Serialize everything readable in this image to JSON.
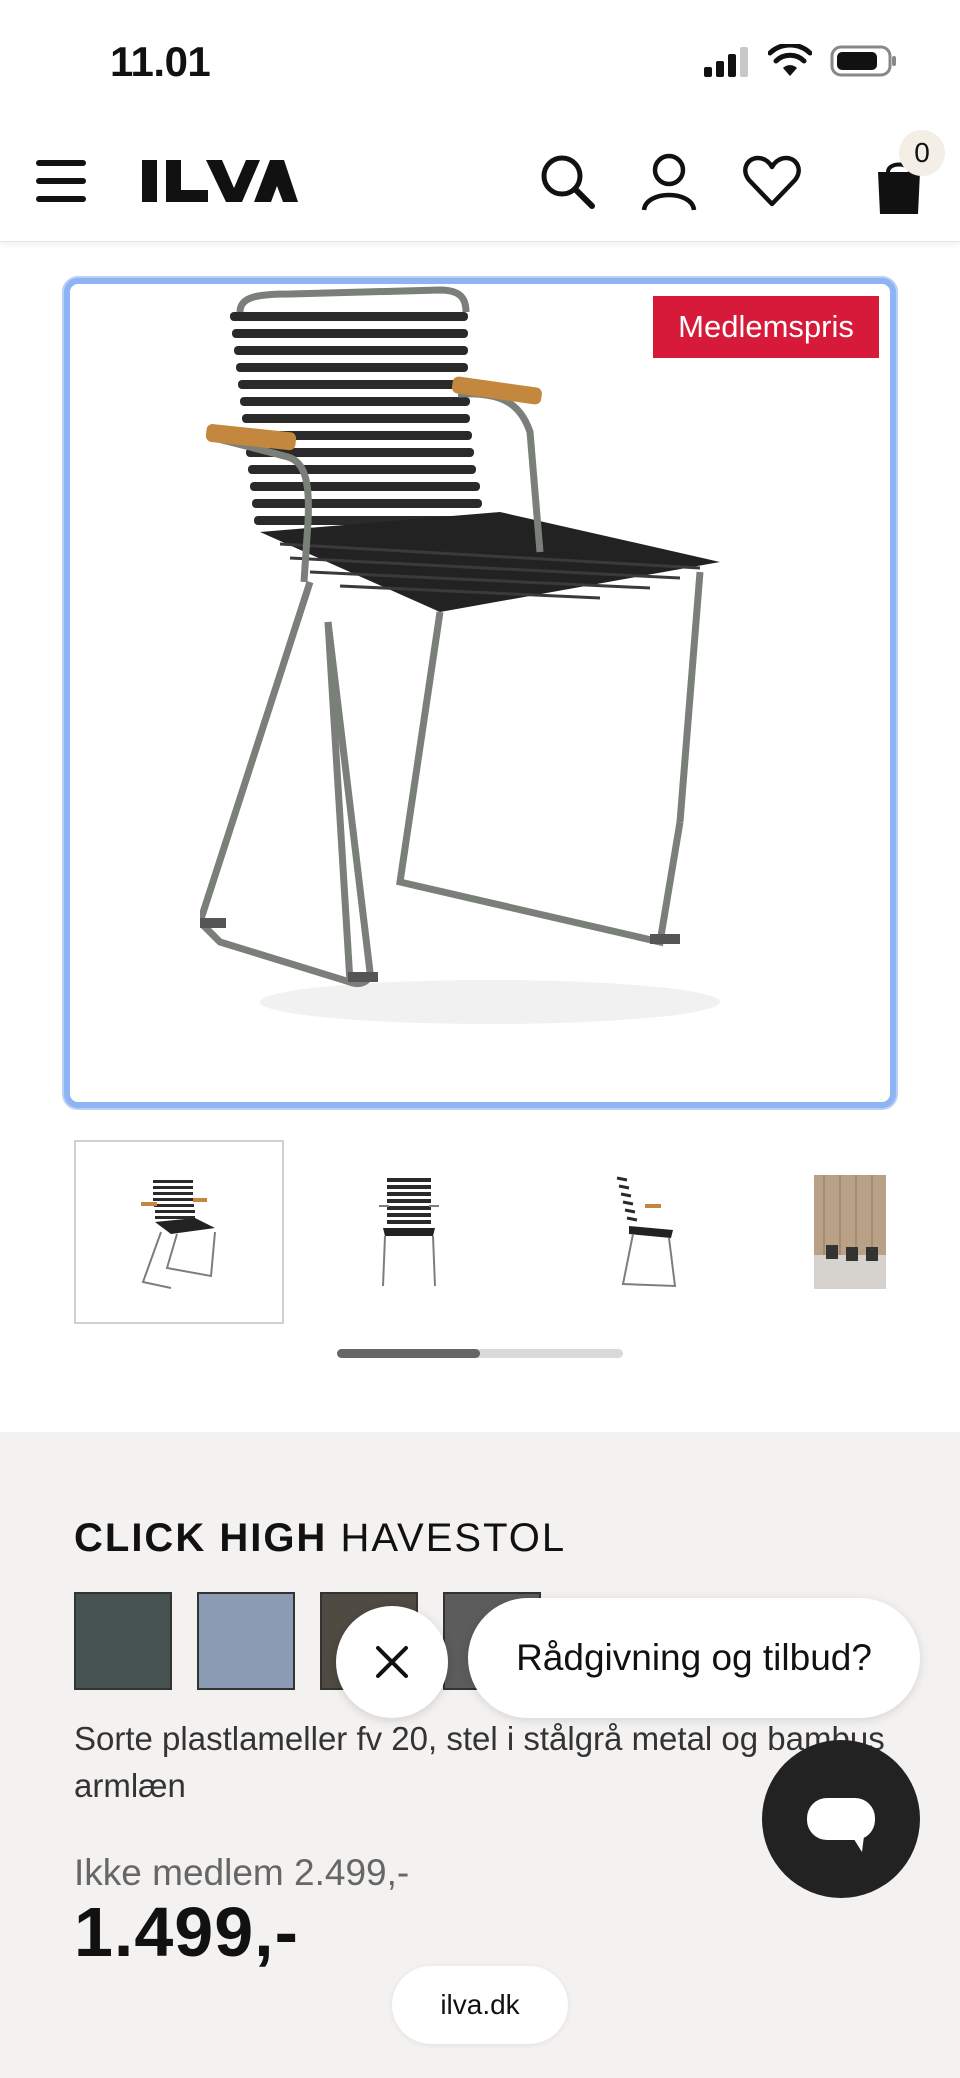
{
  "status_bar": {
    "time": "11.01"
  },
  "header": {
    "logo_text": "ILVA",
    "cart_count": "0",
    "icons": [
      "menu-icon",
      "search-icon",
      "user-icon",
      "heart-icon",
      "cart-icon"
    ]
  },
  "product_image": {
    "badge": "Medlemspris",
    "badge_color": "#d7193a",
    "selected_thumbnail": 1,
    "thumbnail_count": 4,
    "gallery_scroll_fraction": 0.5
  },
  "product": {
    "brand": "CLICK HIGH",
    "name": "HAVESTOL",
    "swatches": [
      "#465250",
      "#8b9bb3",
      "#4f4a42",
      "#5c5c5c"
    ],
    "description": "Sorte plastlameller fv 20, stel i stålgrå metal og bambus armlæn",
    "old_price": "Ikke medlem 2.499,-",
    "price": "1.499,-"
  },
  "chat": {
    "prompt": "Rådgivning og tilbud?",
    "close_icon": "close-icon",
    "fab_icon": "chat-icon"
  },
  "browser": {
    "url": "ilva.dk"
  }
}
